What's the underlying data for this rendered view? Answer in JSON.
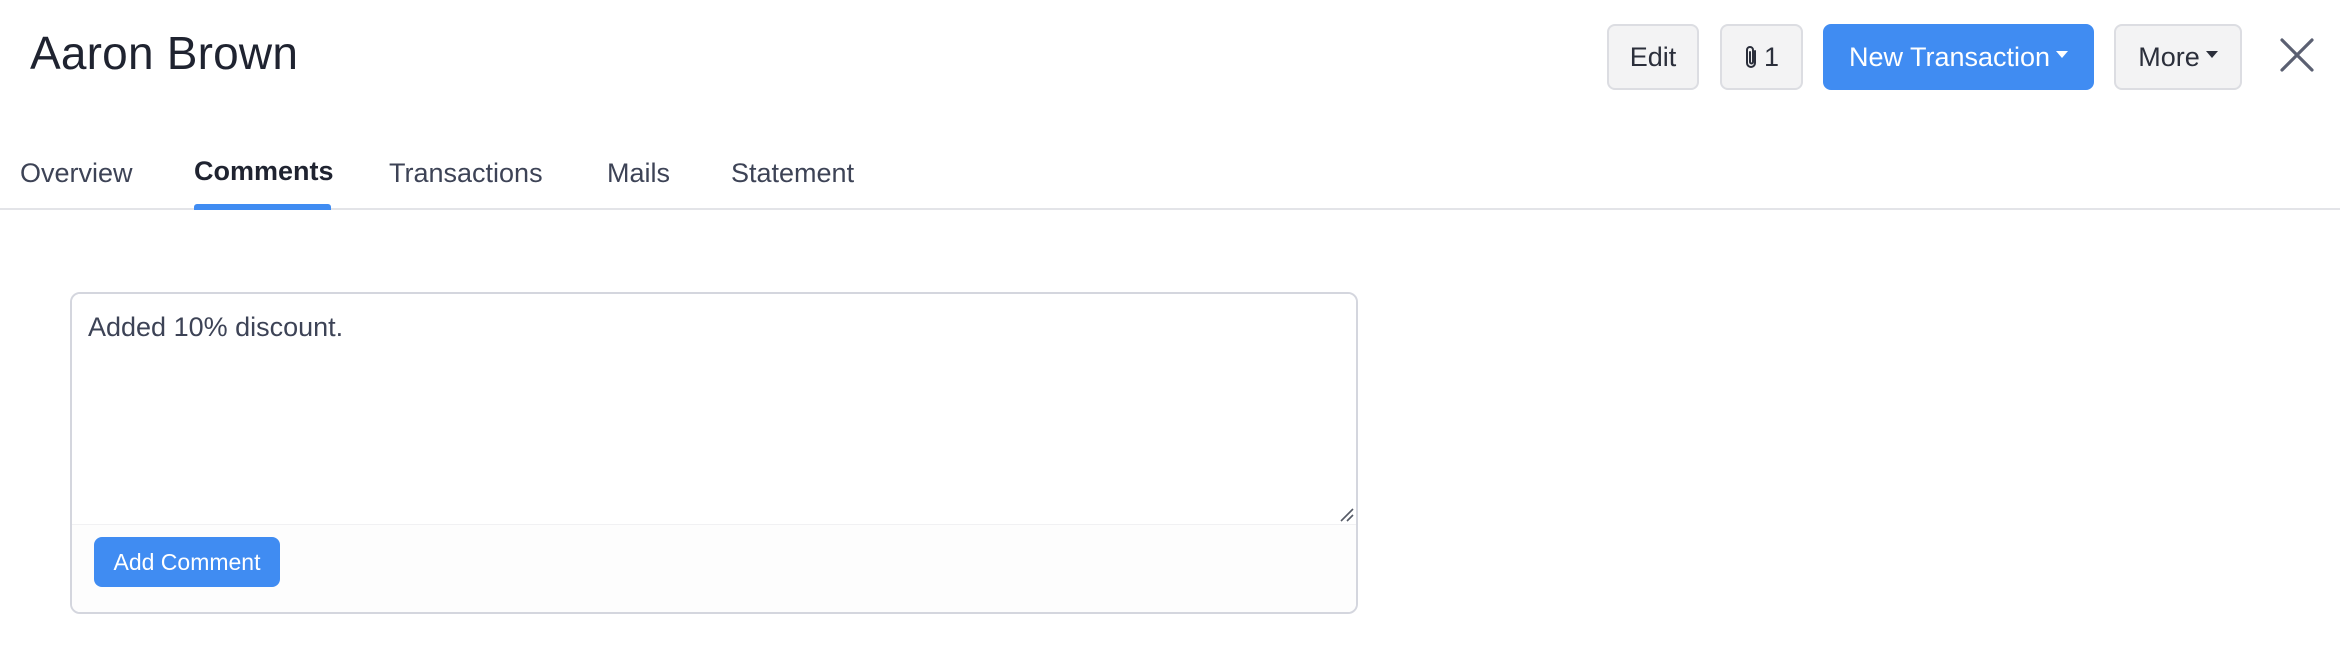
{
  "header": {
    "contact_name": "Aaron Brown",
    "edit_label": "Edit",
    "attachments_count": "1",
    "new_transaction_label": "New Transaction",
    "more_label": "More"
  },
  "tabs": [
    {
      "label": "Overview",
      "active": false
    },
    {
      "label": "Comments",
      "active": true
    },
    {
      "label": "Transactions",
      "active": false
    },
    {
      "label": "Mails",
      "active": false
    },
    {
      "label": "Statement",
      "active": false
    }
  ],
  "comment": {
    "value": "Added 10% discount.",
    "submit_label": "Add Comment"
  },
  "colors": {
    "primary": "#408cf2",
    "text": "#1f2330"
  }
}
